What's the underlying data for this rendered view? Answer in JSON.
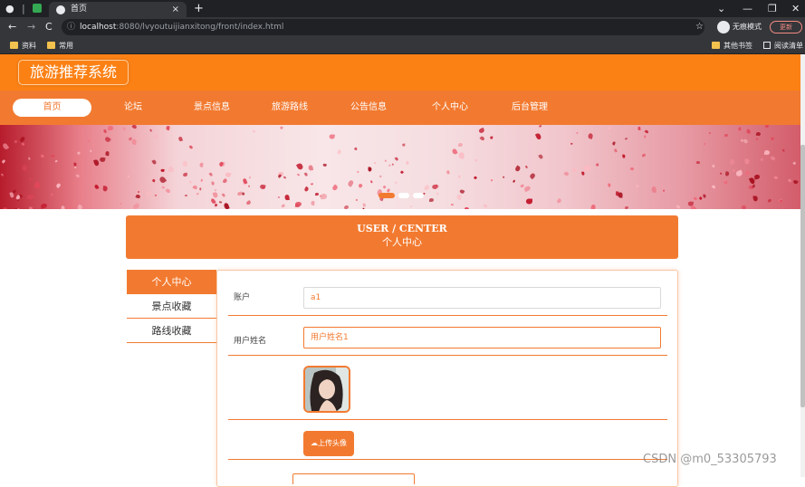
{
  "browser": {
    "tab_title": "首页",
    "new_tab": "+",
    "close_tab": "×",
    "url_host": "localhost",
    "url_path": ":8080/lvyoutuijianxitong/front/index.html",
    "incognito_label": "无痕模式",
    "update_label": "更新",
    "bookmarks": [
      "资料",
      "常用"
    ],
    "bookmarks_right": [
      "其他书签",
      "阅读清单"
    ]
  },
  "site": {
    "logo": "旅游推荐系统",
    "nav": [
      {
        "label": "首页",
        "active": true
      },
      {
        "label": "论坛"
      },
      {
        "label": "景点信息"
      },
      {
        "label": "旅游路线"
      },
      {
        "label": "公告信息"
      },
      {
        "label": "个人中心"
      },
      {
        "label": "后台管理"
      }
    ]
  },
  "user_center": {
    "title_en": "USER / CENTER",
    "title_cn": "个人中心"
  },
  "side_menu": [
    {
      "label": "个人中心",
      "active": true
    },
    {
      "label": "景点收藏"
    },
    {
      "label": "路线收藏"
    }
  ],
  "form": {
    "account_label": "账户",
    "account_value": "a1",
    "name_label": "用户姓名",
    "name_value": "用户姓名1",
    "upload_label": "上传头像"
  },
  "watermark": "CSDN @m0_53305793",
  "colors": {
    "accent": "#f27a30",
    "header": "#fb8115"
  }
}
